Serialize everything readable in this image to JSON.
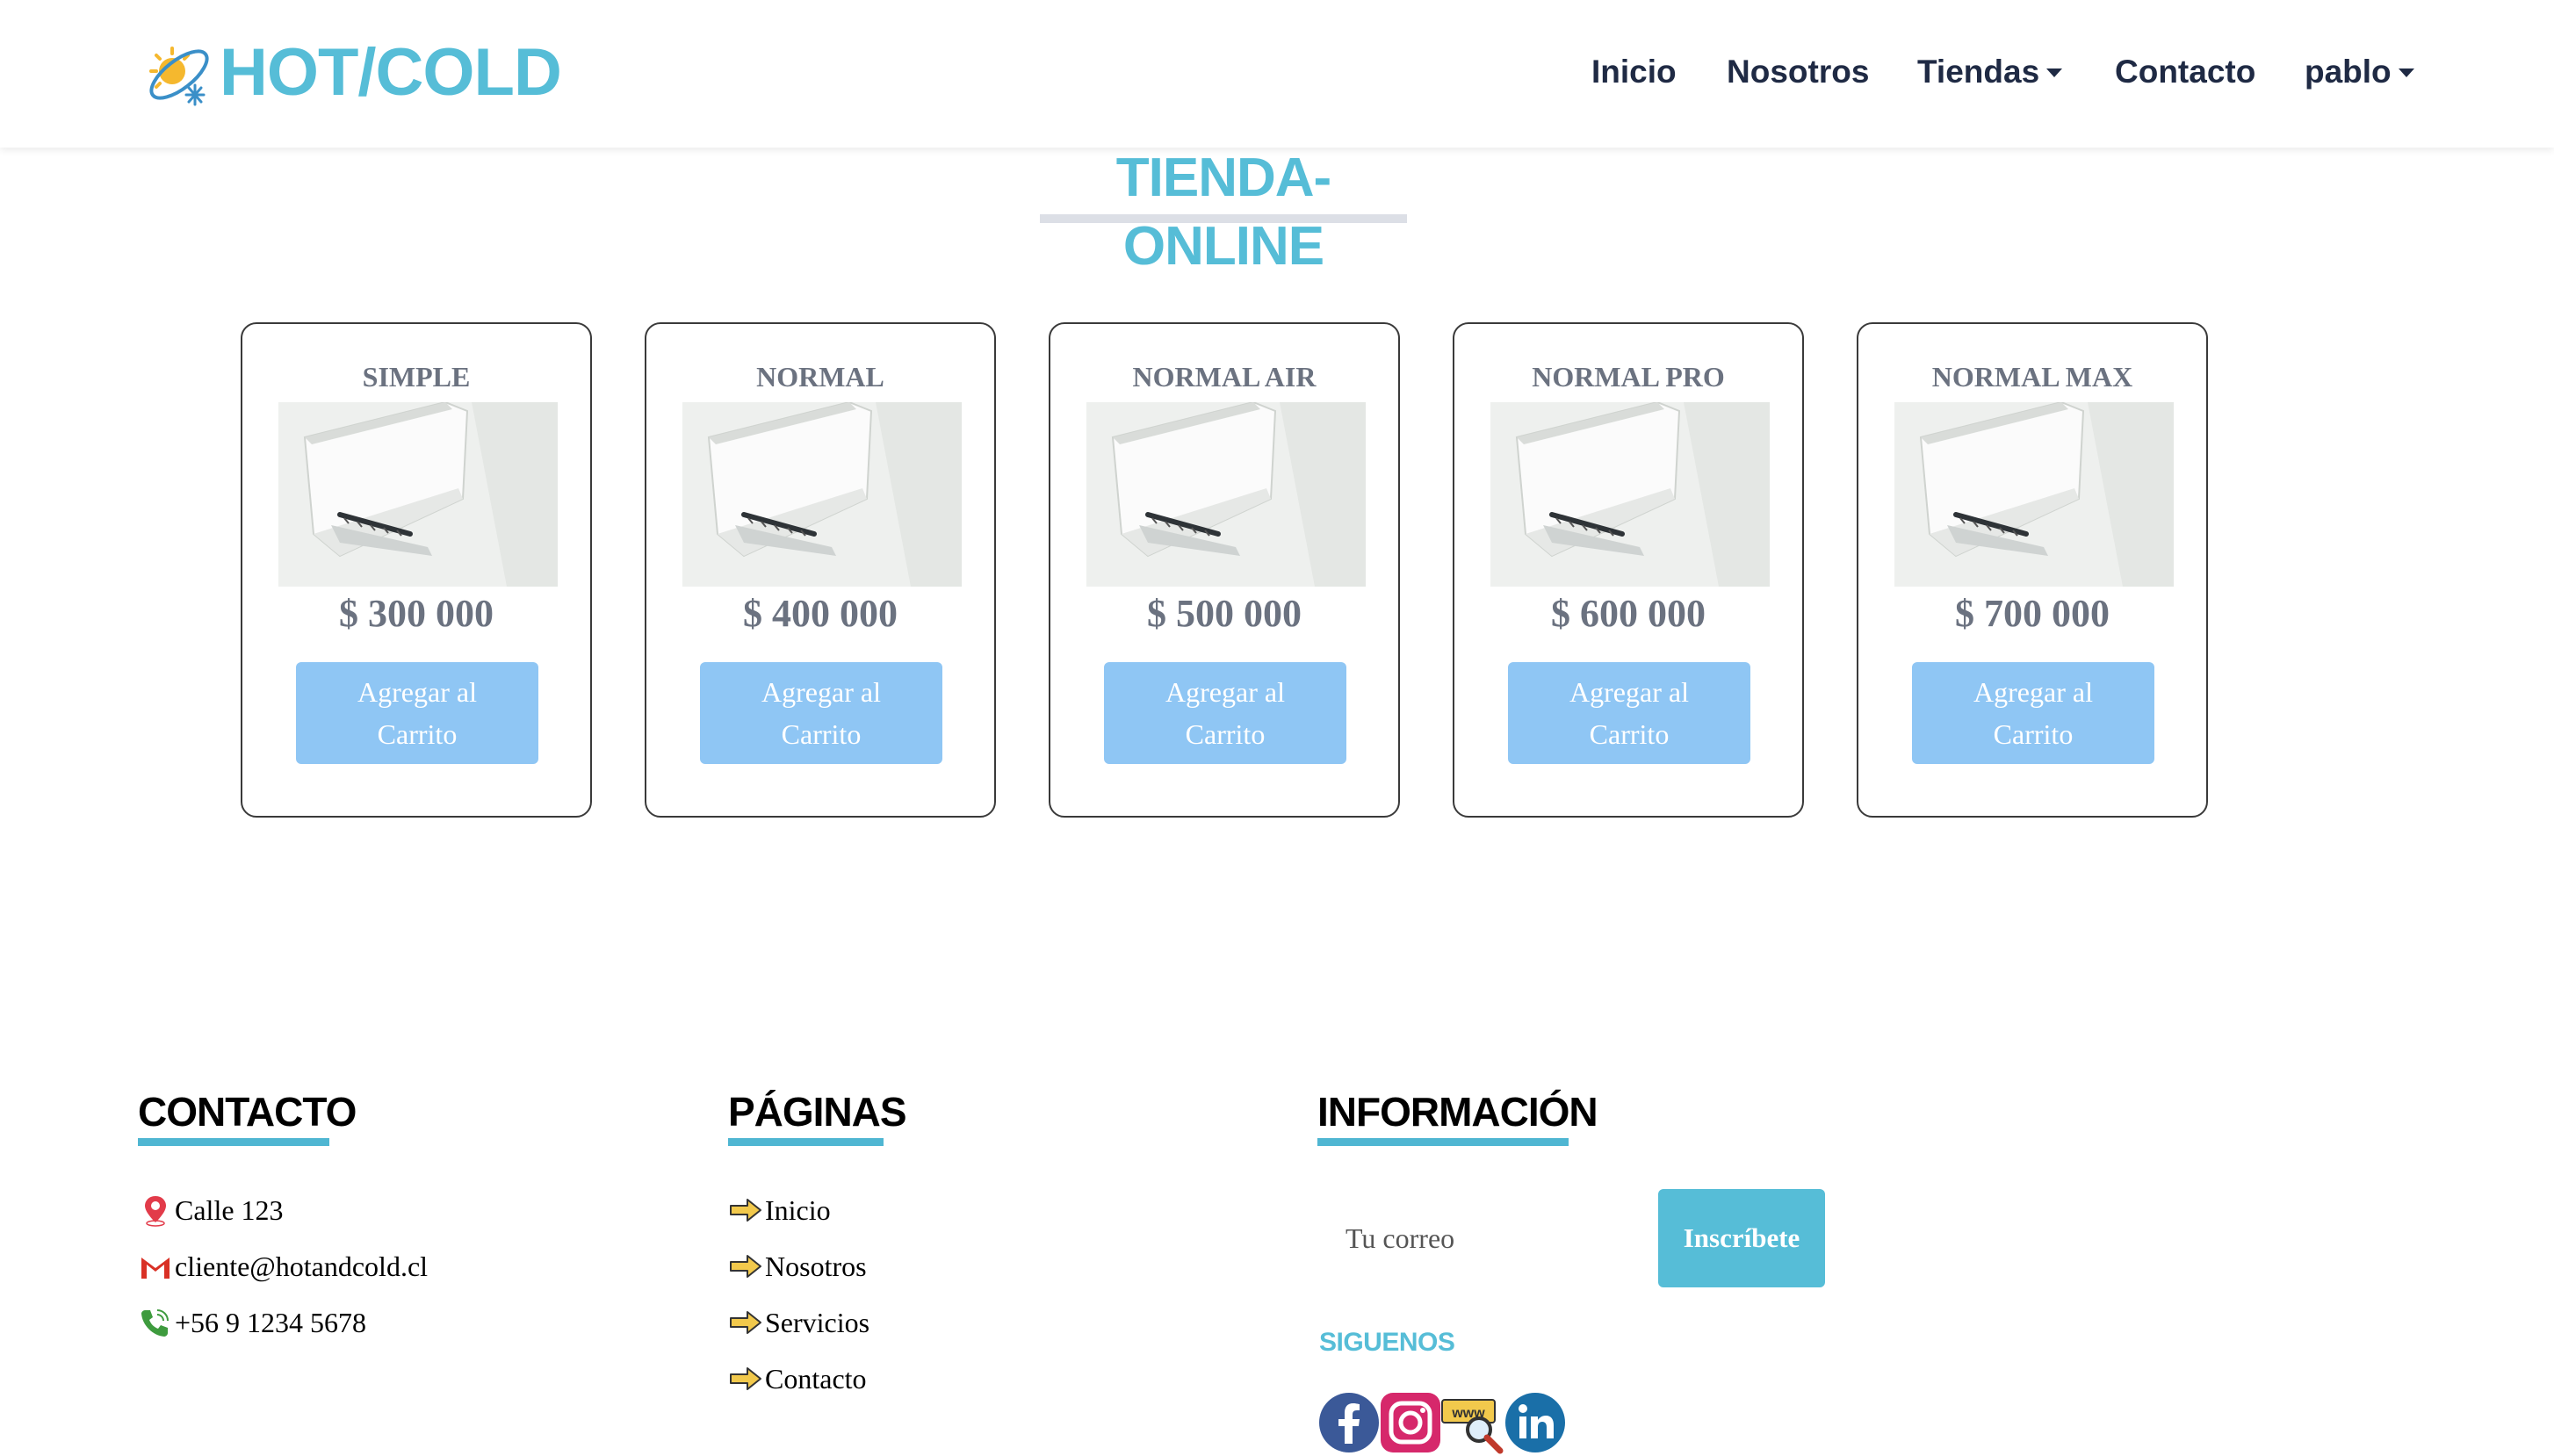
{
  "colors": {
    "brand": "#56bdd7",
    "nav_text": "#1f2a44",
    "button": "#8fc6f4",
    "muted": "#6b7280"
  },
  "brand": {
    "name": "HOT/COLD",
    "logo_icon": "sun-snowflake-logo-icon"
  },
  "nav": {
    "items": [
      {
        "label": "Inicio"
      },
      {
        "label": "Nosotros"
      },
      {
        "label": "Tiendas",
        "dropdown": true
      },
      {
        "label": "Contacto"
      },
      {
        "label": "pablo",
        "dropdown": true
      }
    ]
  },
  "page": {
    "title": "TIENDA-ONLINE"
  },
  "products": [
    {
      "name": "SIMPLE",
      "price": "$ 300 000",
      "button": "Agregar al Carrito",
      "image_icon": "air-conditioner-image"
    },
    {
      "name": "NORMAL",
      "price": "$ 400 000",
      "button": "Agregar al Carrito",
      "image_icon": "air-conditioner-image"
    },
    {
      "name": "NORMAL AIR",
      "price": "$ 500 000",
      "button": "Agregar al Carrito",
      "image_icon": "air-conditioner-image"
    },
    {
      "name": "NORMAL PRO",
      "price": "$ 600 000",
      "button": "Agregar al Carrito",
      "image_icon": "air-conditioner-image"
    },
    {
      "name": "NORMAL MAX",
      "price": "$ 700 000",
      "button": "Agregar al Carrito",
      "image_icon": "air-conditioner-image"
    }
  ],
  "footer": {
    "contact": {
      "heading": "CONTACTO",
      "items": [
        {
          "text": "Calle 123",
          "icon": "location-pin-icon"
        },
        {
          "text": "cliente@hotandcold.cl",
          "icon": "mail-icon"
        },
        {
          "text": "+56 9 1234 5678",
          "icon": "phone-icon"
        }
      ]
    },
    "pages": {
      "heading": "PÁGINAS",
      "items": [
        {
          "text": "Inicio",
          "icon": "arrow-right-icon"
        },
        {
          "text": " Nosotros",
          "icon": "arrow-right-icon"
        },
        {
          "text": " Servicios",
          "icon": "arrow-right-icon"
        },
        {
          "text": " Contacto",
          "icon": "arrow-right-icon"
        }
      ]
    },
    "info": {
      "heading": "INFORMACIÓN",
      "email_placeholder": "Tu correo",
      "subscribe_label": "Inscríbete",
      "follow_label": "SIGUENOS",
      "social": [
        {
          "name": "facebook-icon"
        },
        {
          "name": "instagram-icon"
        },
        {
          "name": "website-search-icon"
        },
        {
          "name": "linkedin-icon"
        }
      ]
    }
  }
}
